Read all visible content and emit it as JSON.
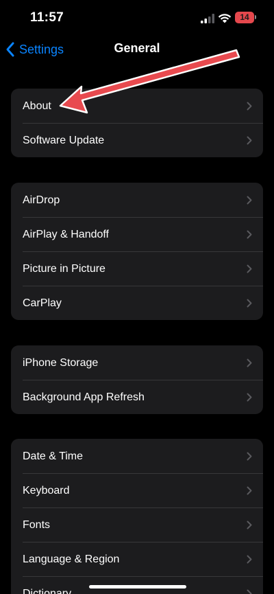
{
  "status_bar": {
    "time": "11:57",
    "battery_level": "14",
    "signal_icon": "cellular-signal-icon",
    "wifi_icon": "wifi-icon",
    "battery_color": "#e5484d"
  },
  "nav": {
    "back_label": "Settings",
    "title": "General",
    "back_icon": "chevron-left-icon",
    "accent": "#0a84ff"
  },
  "groups": [
    {
      "rows": [
        "About",
        "Software Update"
      ]
    },
    {
      "rows": [
        "AirDrop",
        "AirPlay & Handoff",
        "Picture in Picture",
        "CarPlay"
      ]
    },
    {
      "rows": [
        "iPhone Storage",
        "Background App Refresh"
      ]
    },
    {
      "rows": [
        "Date & Time",
        "Keyboard",
        "Fonts",
        "Language & Region",
        "Dictionary"
      ]
    }
  ],
  "annotation": {
    "color": "#e84a4f",
    "points_to": "About"
  }
}
